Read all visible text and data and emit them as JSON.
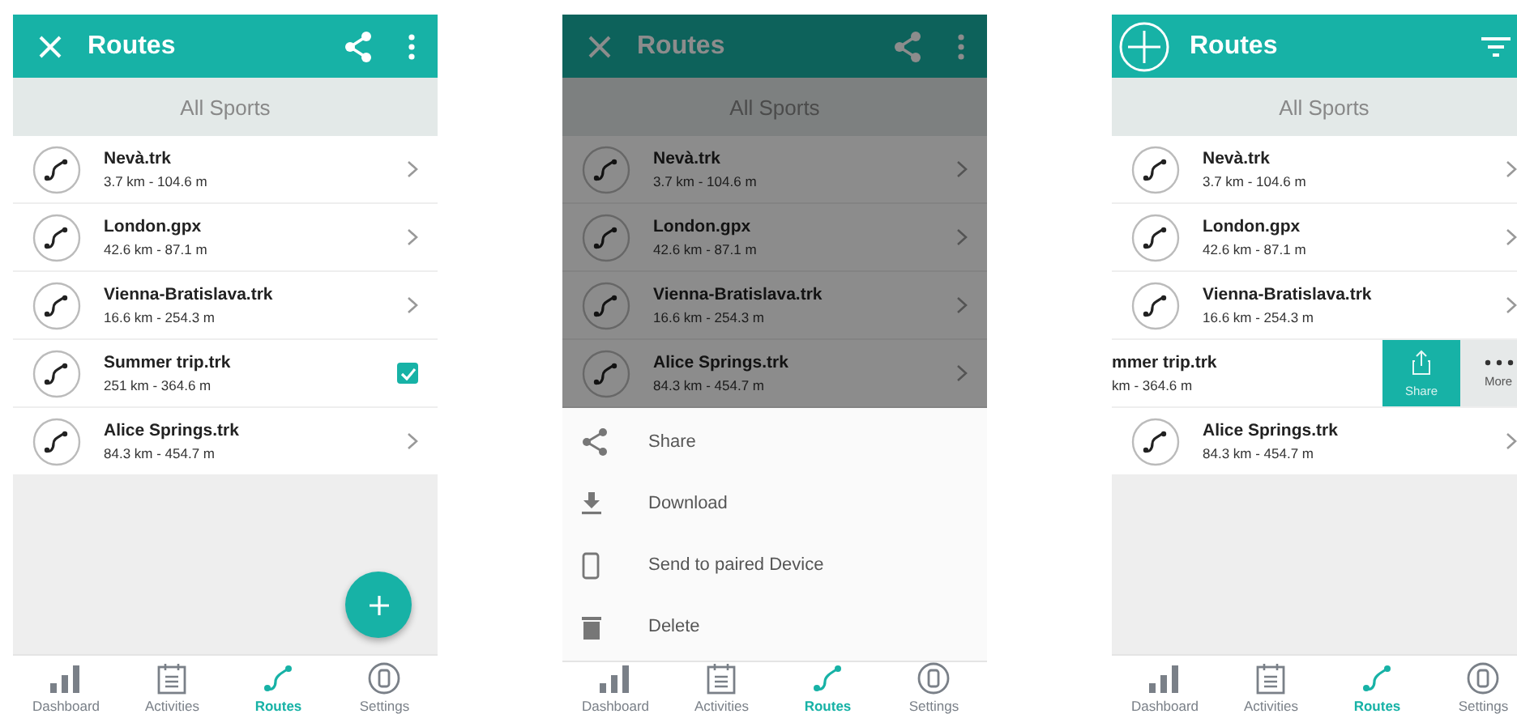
{
  "screens": [
    {
      "header": {
        "kind": "select",
        "title": "Routes"
      },
      "filter": "All Sports",
      "routes": [
        {
          "name": "Nevà.trk",
          "stats": "3.7 km - 104.6 m",
          "checked": false
        },
        {
          "name": "London.gpx",
          "stats": "42.6 km - 87.1 m",
          "checked": false
        },
        {
          "name": "Vienna-Bratislava.trk",
          "stats": "16.6 km - 254.3 m",
          "checked": false
        },
        {
          "name": "Summer trip.trk",
          "stats": "251 km - 364.6 m",
          "checked": true
        },
        {
          "name": "Alice Springs.trk",
          "stats": "84.3 km - 454.7 m",
          "checked": false
        }
      ],
      "fab": true,
      "nav": [
        {
          "label": "Dashboard",
          "selected": false
        },
        {
          "label": "Activities",
          "selected": false
        },
        {
          "label": "Routes",
          "selected": true
        },
        {
          "label": "Settings",
          "selected": false
        }
      ]
    },
    {
      "dimmed": true,
      "header": {
        "kind": "select",
        "title": "Routes"
      },
      "filter": "All Sports",
      "routes": [
        {
          "name": "Nevà.trk",
          "stats": "3.7 km - 104.6 m"
        },
        {
          "name": "London.gpx",
          "stats": "42.6 km - 87.1 m"
        },
        {
          "name": "Vienna-Bratislava.trk",
          "stats": "16.6 km - 254.3 m"
        },
        {
          "name": "Alice Springs.trk",
          "stats": "84.3 km - 454.7 m"
        }
      ],
      "sheet": [
        {
          "kind": "share",
          "label": "Share"
        },
        {
          "kind": "download",
          "label": "Download"
        },
        {
          "kind": "device",
          "label": "Send to paired Device"
        },
        {
          "kind": "delete",
          "label": "Delete"
        }
      ],
      "nav": [
        {
          "label": "Dashboard",
          "selected": false
        },
        {
          "label": "Activities",
          "selected": false
        },
        {
          "label": "Routes",
          "selected": true
        },
        {
          "label": "Settings",
          "selected": false
        }
      ]
    },
    {
      "header": {
        "kind": "browse",
        "title": "Routes"
      },
      "filter": "All Sports",
      "routes": [
        {
          "name": "Nevà.trk",
          "stats": "3.7 km - 104.6 m",
          "swiped": false
        },
        {
          "name": "London.gpx",
          "stats": "42.6 km - 87.1 m",
          "swiped": false
        },
        {
          "name": "Vienna-Bratislava.trk",
          "stats": "16.6 km - 254.3 m",
          "swiped": false
        },
        {
          "name": "mmer trip.trk",
          "stats": "km - 364.6 m",
          "swiped": true,
          "actions": [
            {
              "kind": "share",
              "label": "Share"
            },
            {
              "kind": "more",
              "label": "More"
            }
          ]
        },
        {
          "name": "Alice Springs.trk",
          "stats": "84.3 km - 454.7 m",
          "swiped": false
        }
      ],
      "nav": [
        {
          "label": "Dashboard",
          "selected": false
        },
        {
          "label": "Activities",
          "selected": false
        },
        {
          "label": "Routes",
          "selected": true
        },
        {
          "label": "Settings",
          "selected": false
        }
      ]
    }
  ]
}
